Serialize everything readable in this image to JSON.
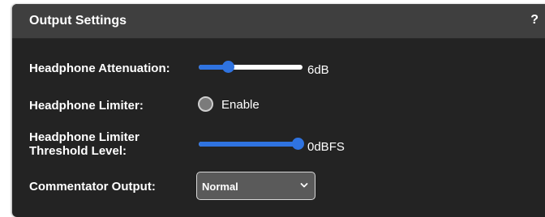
{
  "panel": {
    "title": "Output Settings",
    "help_label": "?"
  },
  "rows": {
    "attenuation": {
      "label": "Headphone Attenuation:",
      "value_text": "6dB",
      "slider_fraction": 0.28
    },
    "limiter": {
      "label": "Headphone Limiter:",
      "option_label": "Enable",
      "checked": false
    },
    "threshold": {
      "label_line1": "Headphone Limiter",
      "label_line2": "Threshold Level:",
      "value_text": "0dBFS",
      "slider_fraction": 0.95
    },
    "commentator": {
      "label": "Commentator Output:",
      "selected": "Normal"
    }
  },
  "colors": {
    "accent": "#2f73e0",
    "panel_bg": "#232323",
    "header_bg": "#3f3f3f"
  },
  "icons": {
    "dropdown": "chevron-down-icon"
  }
}
